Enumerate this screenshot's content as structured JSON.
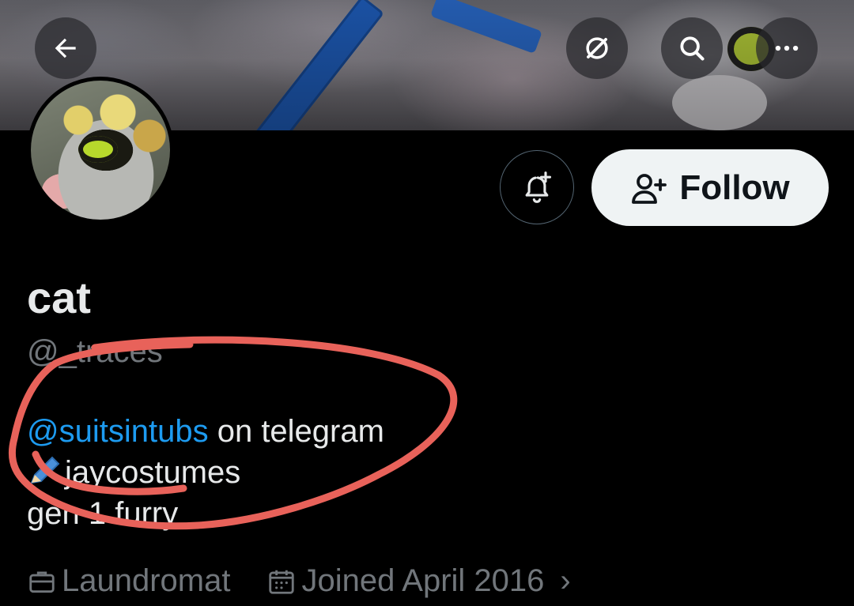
{
  "header": {
    "back_icon": "arrow-left-icon",
    "grok_icon": "grok-icon",
    "search_icon": "search-icon",
    "more_icon": "more-horizontal-icon"
  },
  "profile": {
    "display_name": "cat",
    "handle": "@_traces",
    "bio": {
      "mention": "@suitsintubs",
      "line1_rest": " on telegram",
      "line2_text": "jaycostumes",
      "line3": "gen 1 furry"
    },
    "location": "Laundromat",
    "joined": "Joined April 2016"
  },
  "actions": {
    "notify_icon": "bell-plus-icon",
    "follow_label": "Follow",
    "follow_icon": "person-plus-icon"
  },
  "colors": {
    "background": "#000000",
    "text_primary": "#e7e9ea",
    "text_secondary": "#71767b",
    "link": "#1d9bf0",
    "follow_bg": "#eff3f4",
    "annotation": "#e8625a"
  }
}
